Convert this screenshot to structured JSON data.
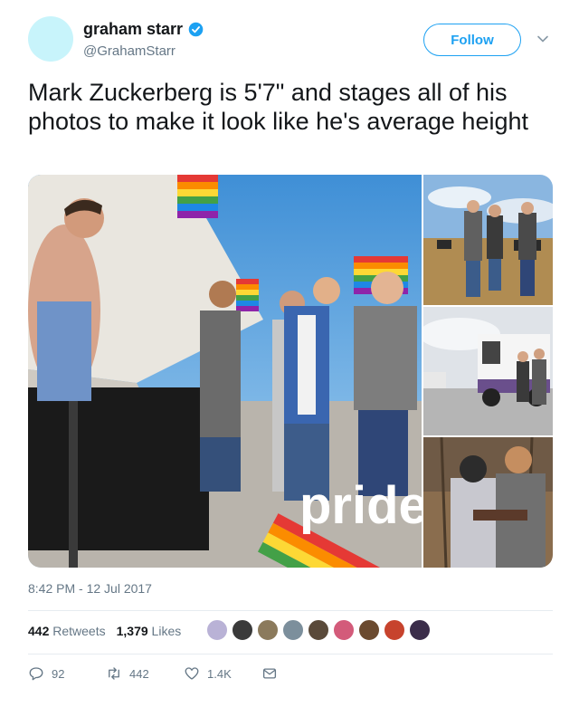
{
  "user": {
    "display_name": "graham starr",
    "handle": "@GrahamStarr",
    "verified": true,
    "avatar_color": "#c8f4fb"
  },
  "follow_button": {
    "label": "Follow"
  },
  "tweet": {
    "text": "Mark Zuckerberg is 5'7\" and stages all of his photos to make it look like he's average height",
    "timestamp": "8:42 PM - 12 Jul 2017",
    "media": {
      "overlay_text": "pride"
    }
  },
  "stats": {
    "retweets_count": "442",
    "retweets_label": "Retweets",
    "likes_count": "1,379",
    "likes_label": "Likes"
  },
  "likers": [
    "#b9b2d6",
    "#3a3a3a",
    "#8b7a5c",
    "#7c8f9c",
    "#5a4a3a",
    "#d35b7a",
    "#6b4a2f",
    "#c7432d",
    "#3b2d4a"
  ],
  "actions": {
    "reply_count": "92",
    "retweet_count": "442",
    "like_count": "1.4K"
  },
  "colors": {
    "accent": "#1da1f2",
    "secondary_text": "#657786",
    "divider": "#e6ecf0"
  }
}
